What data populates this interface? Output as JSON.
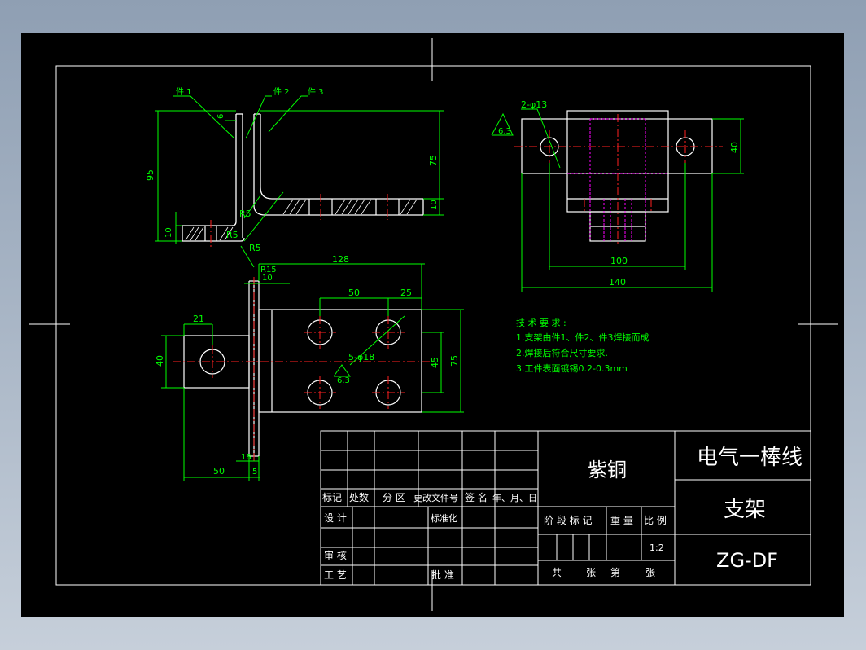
{
  "colors": {
    "background": "#000000",
    "frame": "#ffffff",
    "geometry": "#ffffff",
    "dimension": "#00ff00",
    "centerline": "#ff2020",
    "hidden": "#ff00ff",
    "hatch": "#ffffff",
    "text": "#ffffff"
  },
  "labels": {
    "part1": "件 1",
    "part2": "件 2",
    "part3": "件 3",
    "r5a": "R5",
    "r5b": "R5",
    "r5c": "R5",
    "r15": "R15",
    "holes_top": "2-φ13",
    "holes_front": "5-φ18",
    "rough_top": "6.3",
    "rough_front": "6.3"
  },
  "dimensions": {
    "d6": "6",
    "d95": "95",
    "d75a": "75",
    "d10a": "10",
    "d10b": "10",
    "d100": "100",
    "d140": "140",
    "d40a": "40",
    "d128": "128",
    "d10c": "10",
    "d50a": "50",
    "d25": "25",
    "d21": "21",
    "d40b": "40",
    "d45": "45",
    "d75b": "75",
    "d18": "18",
    "d50b": "50",
    "d5": "5"
  },
  "notes": {
    "title": "技 术 要 求 :",
    "n1": "1.支架由件1、件2、件3焊接而成",
    "n2": "2.焊接后符合尺寸要求.",
    "n3": "3.工件表面镀锡0.2-0.3mm"
  },
  "title_block": {
    "material": "紫铜",
    "product": "电气一棒线",
    "part_name": "支架",
    "code": "ZG-DF",
    "scale": "1:2",
    "rev_headers": [
      "标记",
      "处数",
      "分 区",
      "更改文件号",
      "签 名",
      "年、月、日"
    ],
    "design": "设 计",
    "standard": "标准化",
    "review": "审 核",
    "process": "工 艺",
    "approve": "批 准",
    "stage_mark": "阶 段 标 记",
    "weight": "重 量",
    "ratio": "比 例",
    "total": "共",
    "sheets": "张",
    "no": "第",
    "sheet": "张"
  }
}
